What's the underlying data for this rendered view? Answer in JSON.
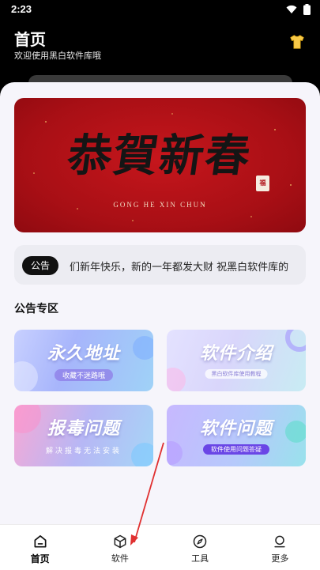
{
  "status_bar": {
    "time": "2:23"
  },
  "header": {
    "title": "首页",
    "subtitle": "欢迎使用黑白软件库哦"
  },
  "banner": {
    "main_text": "恭賀新春",
    "pinyin": "GONG HE XIN CHUN",
    "seal": "福"
  },
  "notice": {
    "badge": "公告",
    "text": "们新年快乐，新的一年都发大财 祝黑白软件库的"
  },
  "section": {
    "title": "公告专区"
  },
  "tiles": [
    {
      "title": "永久地址",
      "subtitle": "收藏不迷路哦"
    },
    {
      "title": "软件介绍",
      "subtitle": "黑白软件库使用教程"
    },
    {
      "title": "报毒问题",
      "subtitle": "解决报毒无法安装"
    },
    {
      "title": "软件问题",
      "subtitle": "软件使用问题答疑"
    }
  ],
  "tabs": [
    {
      "label": "首页",
      "icon": "home-icon",
      "active": true
    },
    {
      "label": "软件",
      "icon": "cube-icon"
    },
    {
      "label": "工具",
      "icon": "compass-icon"
    },
    {
      "label": "更多",
      "icon": "user-icon"
    }
  ],
  "colors": {
    "accent": "#111111",
    "banner_red": "#b5121a",
    "annotation_arrow": "#e03030"
  }
}
